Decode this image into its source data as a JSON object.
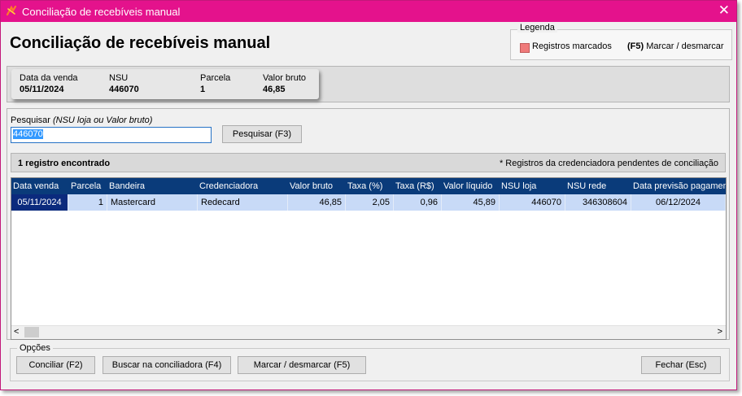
{
  "window": {
    "title": "Conciliação de recebíveis manual",
    "close_symbol": "✕"
  },
  "page": {
    "title": "Conciliação de recebíveis  manual"
  },
  "legend": {
    "title": "Legenda",
    "marked_label": "Registros marcados",
    "marked_color": "#ef7a7a",
    "shortcut_key": "(F5)",
    "shortcut_label": " Marcar / desmarcar"
  },
  "sale_info": {
    "date_label": "Data da venda",
    "date_value": "05/11/2024",
    "nsu_label": "NSU",
    "nsu_value": "446070",
    "parcela_label": "Parcela",
    "parcela_value": "1",
    "valor_label": "Valor bruto",
    "valor_value": "46,85"
  },
  "search": {
    "label": "Pesquisar ",
    "hint": "(NSU loja ou Valor bruto)",
    "value": "446070",
    "button_label": "Pesquisar (F3)"
  },
  "results": {
    "count_text": "1 registro encontrado",
    "note": "* Registros da credenciadora pendentes de conciliação"
  },
  "table": {
    "columns": [
      "Data venda",
      "Parcela",
      "Bandeira",
      "Credenciadora",
      "Valor bruto",
      "Taxa (%)",
      "Taxa (R$)",
      "Valor líquido",
      "NSU loja",
      "NSU rede",
      "Data previsão pagamen"
    ],
    "rows": [
      [
        "05/11/2024",
        "1",
        "Mastercard",
        "Redecard",
        "46,85",
        "2,05",
        "0,96",
        "45,89",
        "446070",
        "346308604",
        "06/12/2024"
      ]
    ],
    "header_color": "#0a3b7a",
    "row_color": "#c8daf7"
  },
  "options": {
    "title": "Opções",
    "conciliar_label": "Conciliar (F2)",
    "buscar_label": "Buscar na conciliadora (F4)",
    "marcar_label": "Marcar / desmarcar (F5)",
    "fechar_label": "Fechar (Esc)"
  },
  "colors": {
    "titlebar": "#e4128c",
    "selection": "#0b2a7d"
  }
}
